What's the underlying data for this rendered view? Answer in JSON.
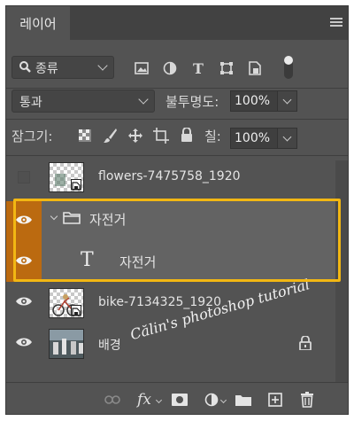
{
  "panel": {
    "tab_label": "레이어"
  },
  "filter": {
    "kind_label": "종류"
  },
  "blend": {
    "mode_label": "통과",
    "opacity_label": "불투명도:",
    "opacity_value": "100%"
  },
  "lock": {
    "label": "잠그기:",
    "fill_label": "칠:",
    "fill_value": "100%"
  },
  "layers": [
    {
      "name": "flowers-7475758_1920",
      "visible": false,
      "type": "smart-object"
    },
    {
      "name": "자전거",
      "visible": true,
      "type": "group",
      "selected": true,
      "expanded": true
    },
    {
      "name": "자전거",
      "visible": true,
      "type": "text",
      "selected": true
    },
    {
      "name": "bike-7134325_1920",
      "visible": true,
      "type": "smart-object"
    },
    {
      "name": "배경",
      "visible": true,
      "type": "background",
      "locked": true
    }
  ],
  "watermark": "Călin's photoshop tutorial",
  "colors": {
    "panel_bg": "#535353",
    "selected_bg": "#636363",
    "eye_highlight": "#bb6a10",
    "annotation_outline": "#f2b713"
  }
}
